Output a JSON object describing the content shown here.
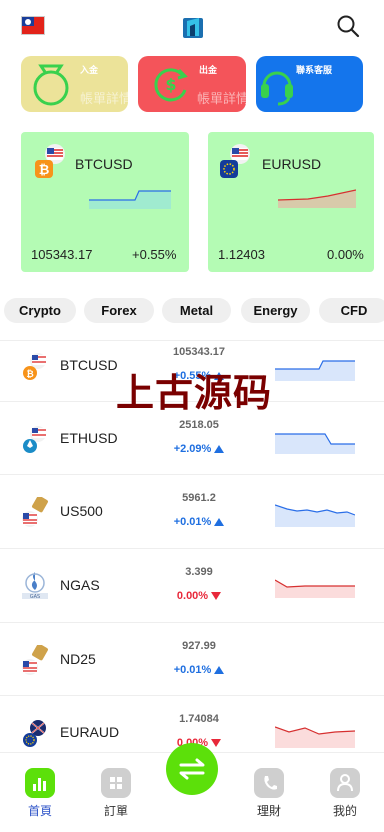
{
  "header": {
    "flag": "taiwan-flag-icon",
    "logo": "app-logo-icon",
    "search": "search-icon"
  },
  "quick_actions": [
    {
      "title": "入金",
      "subtitle": "帳單詳情",
      "icon": "money-bag-icon"
    },
    {
      "title": "出金",
      "subtitle": "帳單詳情",
      "icon": "dollar-cycle-icon"
    },
    {
      "title": "聯系客服",
      "subtitle": "",
      "icon": "headset-icon"
    }
  ],
  "featured": [
    {
      "symbol": "BTCUSD",
      "price": "105343.17",
      "change": "+0.55%",
      "trend": "up"
    },
    {
      "symbol": "EURUSD",
      "price": "1.12403",
      "change": "0.00%",
      "trend": "down"
    }
  ],
  "categories": [
    "Crypto",
    "Forex",
    "Metal",
    "Energy",
    "CFD"
  ],
  "markets": [
    {
      "symbol": "BTCUSD",
      "price": "105343.17",
      "change": "+0.55%",
      "direction": "up"
    },
    {
      "symbol": "ETHUSD",
      "price": "2518.05",
      "change": "+2.09%",
      "direction": "up"
    },
    {
      "symbol": "US500",
      "price": "5961.2",
      "change": "+0.01%",
      "direction": "up"
    },
    {
      "symbol": "NGAS",
      "price": "3.399",
      "change": "0.00%",
      "direction": "down"
    },
    {
      "symbol": "ND25",
      "price": "927.99",
      "change": "+0.01%",
      "direction": "up"
    },
    {
      "symbol": "EURAUD",
      "price": "1.74084",
      "change": "0.00%",
      "direction": "down"
    }
  ],
  "watermark": "上古源码",
  "nav": [
    {
      "label": "首頁",
      "icon": "chart-icon",
      "active": true
    },
    {
      "label": "訂單",
      "icon": "grid-icon",
      "active": false
    },
    {
      "label": "",
      "icon": "swap-icon",
      "active": false
    },
    {
      "label": "理財",
      "icon": "phone-icon",
      "active": false
    },
    {
      "label": "我的",
      "icon": "user-icon",
      "active": false
    }
  ],
  "colors": {
    "green_card": "#b4fbb4",
    "up": "#1f6fe0",
    "down": "#e8283a",
    "nav_active": "#5ce00a"
  }
}
